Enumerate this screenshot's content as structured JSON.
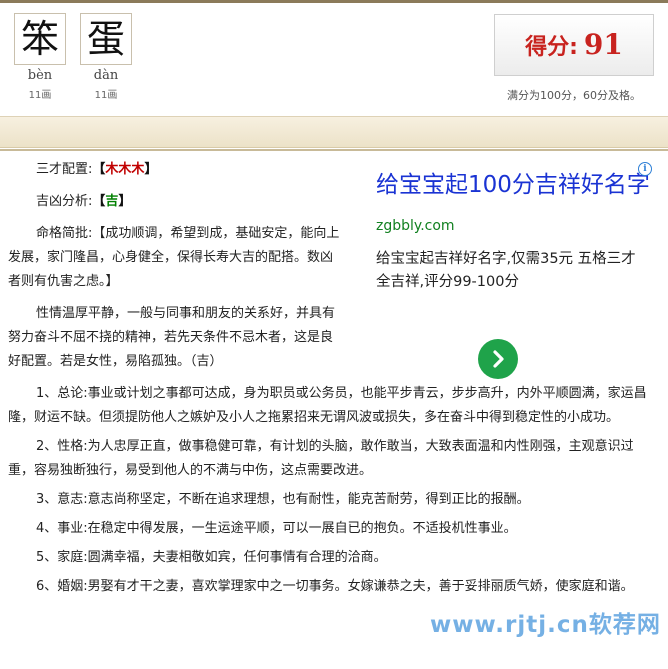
{
  "chars": [
    {
      "char": "笨",
      "pinyin": "bèn",
      "strokes": "11画"
    },
    {
      "char": "蛋",
      "pinyin": "dàn",
      "strokes": "11画"
    }
  ],
  "score": {
    "label": "得分:",
    "value": "91",
    "note": "满分为100分，60分及格。"
  },
  "analysis": {
    "sancai_label": "三才配置:",
    "sancai_open": "【",
    "sancai_value": "木木木",
    "sancai_close": "】",
    "jixiong_label": "吉凶分析:",
    "jixiong_open": "【",
    "jixiong_value": "吉",
    "jixiong_close": "】",
    "hege": "命格简批:【成功顺调，希望到成，基础安定，能向上发展，家门隆昌，心身健全，保得长寿大吉的配搭。数凶者则有仇害之虑。】",
    "xingqing": "性情温厚平静，一般与同事和朋友的关系好，并具有努力奋斗不屈不挠的精神，若先天条件不忌木者，这是良好配置。若是女性，易陷孤独。（吉）",
    "items": [
      "1、总论:事业或计划之事都可达成，身为职员或公务员，也能平步青云，步步高升，内外平顺圆满，家运昌隆，财运不缺。但须提防他人之嫉妒及小人之拖累招来无谓风波或损失，多在奋斗中得到稳定性的小成功。",
      "2、性格:为人忠厚正直，做事稳健可靠，有计划的头脑，敢作敢当，大致表面温和内性刚强，主观意识过重，容易独断独行，易受到他人的不满与中伤，这点需要改进。",
      "3、意志:意志尚称坚定，不断在追求理想，也有耐性，能克苦耐劳，得到正比的报酬。",
      "4、事业:在稳定中得发展，一生运途平顺，可以一展自已的抱负。不适投机性事业。",
      "5、家庭:圆满幸福，夫妻相敬如宾，任何事情有合理的洽商。",
      "6、婚姻:男娶有才干之妻，喜欢掌理家中之一切事务。女嫁谦恭之夫，善于妥排丽质气娇，使家庭和谐。"
    ]
  },
  "ad": {
    "title": "给宝宝起100分吉祥好名字",
    "url": "zgbbly.com",
    "desc": "给宝宝起吉祥好名字,仅需35元 五格三才全吉祥,评分99-100分",
    "info_icon": "i"
  },
  "watermark": "www.rjtj.cn软荐网",
  "colors": {
    "score_red": "#c8231f",
    "wood_red": "#c00000",
    "ji_green": "#008000",
    "ad_blue": "#1a33d3",
    "ad_url_green": "#118020",
    "ad_button_green": "#1fa34a"
  }
}
